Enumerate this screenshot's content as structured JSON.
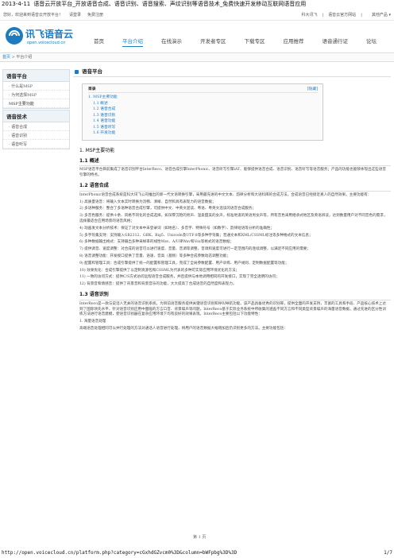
{
  "header_line": {
    "date": "2013-4-11",
    "title": "语音云开放平台_开放语音合成、语音识别、语音搜索、声纹识别等语音技术_免费快速开发移动互联网语音应用"
  },
  "topbar": {
    "welcome": "您好，欢迎来到语音云开放平台！",
    "login": "请登录",
    "register": "免费注册",
    "right": [
      "科大讯飞",
      "语音云官方网站",
      "其他产品"
    ]
  },
  "logo": {
    "text": "讯飞语音云",
    "url": "open.voicecloud.cn"
  },
  "nav": [
    "首页",
    "平台介绍",
    "在线演示",
    "开发者专区",
    "下载专区",
    "应用推荐",
    "语音通行证",
    "论坛"
  ],
  "breadcrumb": {
    "home": "首页",
    "current": "平台介绍"
  },
  "sidebar": {
    "section1": {
      "title": "语音平台",
      "items": [
        "· 什么是MSP",
        "· 为何选择MSP",
        "MSP主要功能"
      ]
    },
    "section2": {
      "title": "语音技术",
      "items": [
        "· 语音合成",
        "· 语音识别",
        "· 语音听写"
      ]
    }
  },
  "main": {
    "title": "语音平台",
    "toc": {
      "title": "目录",
      "hide": "[隐藏]",
      "items": [
        {
          "level": 1,
          "text": "1. MSP主要功能"
        },
        {
          "level": 2,
          "text": "1.1 概述"
        },
        {
          "level": 2,
          "text": "1.2 语音合成"
        },
        {
          "level": 2,
          "text": "1.3 语音识别"
        },
        {
          "level": 2,
          "text": "1.4 语音功能"
        },
        {
          "level": 2,
          "text": "1.5 语音听写"
        },
        {
          "level": 2,
          "text": "1.6 开发功能"
        }
      ]
    },
    "h1": "1. MSP主要功能",
    "s11": "1.1 概述",
    "p11": "MSP语音平台目前集成了语音识别平台InterReco、语音合成引擎InterPhonic、语音听写引擎iAT、能够提供语音合成、语音识别、语音听写等语音服务；产品的功能也能够体现出这些语音引擎的特点。",
    "s12": "1.2 语音合成",
    "p12": [
      "InterPhonic语音合成系统是科大讯飞公司推出的新一代文语转换引擎，采用最先进的中文文本、韵律分析和大语料库的合成方法，合成语音已经接近真人的自然效果。主要功能有：",
      "1) 高质量语音：将输入文本实时转换为流畅、清晰、自然和具有表现力的语音数据；",
      "2) 多语种服务：整合了多语种语音合成引擎，可提供中文、中英文混读、粤语、粤英文混读的语音合成服务；",
      "3) 多音色服务：提供十余、风格不同化的合成选择，如深厚沉稳的男声、温柔甜美的女声，标准地道的英语男女声等，所有音色采用继承式地区及英语辨读，达到数量用户对不同音色的需求，选择最适合应用场景的语音风格；",
      "4) 动画发文本分析技术：保证了对文本中未登录词（如地名）、多音字、特殊符号（如数字）、韵律短语等分析的准确性；",
      "5) 多字符集支持：支持输入GB2312、GBK、Big5、Unicode及UTF-8等多种字符集；普通文本和XML/CSSML标注等多种格式的文本信息；",
      "6) 多种数据输出格式：支持输出多种采样率的线性Wav、A/U律Wav和Vox等格式的语音数据；",
      "7) 提供调音、速度调整：对合成的语音可以进行速度、音量、音调等调整，音调和速度可进行一定范围内的连续调整，以满足不同应用的需要；",
      "8) 语音调整功能：开发接口提供了音量、语速、音高（基频）等多种合成参数动态调整功能；",
      "9) 配置和管理工具：合成引擎提供了统一的配置和管理工具，完成了全局参数配置、用户训练、用户规则、定制数据配置等功能；",
      "10) 效果优化：合成引擎提供了以定制资源包和CSSML为代表的多种可实际应用环境优化的方法；",
      "11) 一致的访问方式：提供C/S方式访问远程语音合成服务，并且提供与本地调用相同的开发接口，实现了完全透明的访问；",
      "12) 背景音和情感音：提供了背景音和背景音乐的功能，大大提高了合成语音的自然度和表现力。"
    ],
    "s13": "1.3 语音识别",
    "p13": [
      "InterReco是一款与说话人无关的语音识别系统，为目前语音服务提供关键语音识别和呼叫导航功能。该产品具备优秀的识别率，提供全面的开发支持，丰富的工具和手段、产品核心技术上达到了国际领先水平，针对语音识别应用中面临的方言口音、背景噪声等问题，InterReco基于实际业务系统中所收集的涵盖不同方言和不同类型背景噪声的海量语音数据，通过先进的区分性训练方法进行语音建模，使语音识别器在复杂应用环境下均有良好的效果表现。InterReco主要包括以下功能特性：",
      "1. 海量语音处理",
      "高端语音处理相同可以并行处理的方法对通话人语音进行处理，将用户的语音数据大幅增加后仍识别更多的方法。主要功能包括："
    ]
  },
  "page_number": "第 1 页",
  "footer": {
    "url": "http://open.voicecloud.cn/platform.php?category=cGxhdGZvcm0%3D&column=bWFpbg%3D%3D",
    "page": "1/7"
  }
}
